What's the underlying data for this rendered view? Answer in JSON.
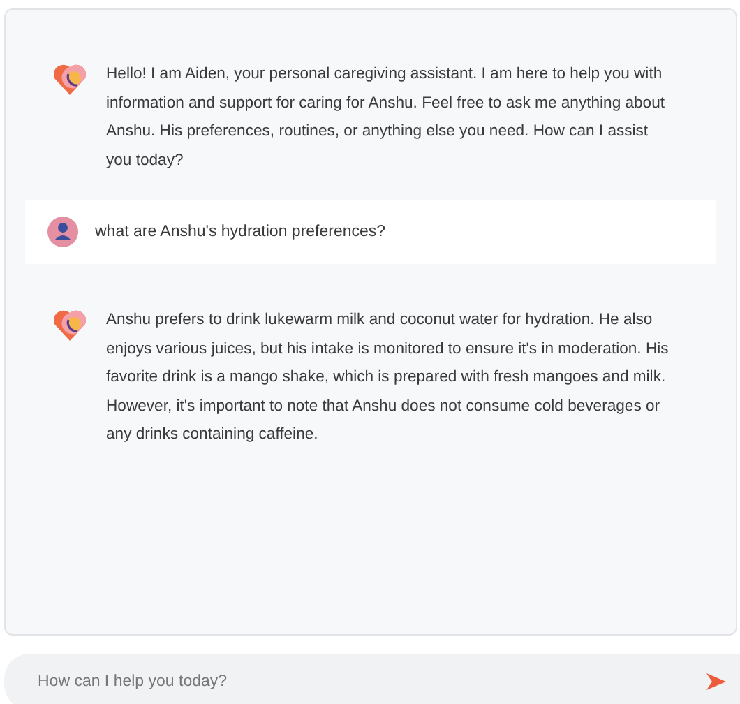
{
  "messages": [
    {
      "kind": "bot",
      "text": "Hello! I am Aiden, your personal caregiving assistant. I am here to help you with information and support for caring for Anshu. Feel free to ask me anything about Anshu. His preferences, routines, or anything else you need. How can I assist you today?"
    },
    {
      "kind": "user",
      "text": "what are Anshu's hydration preferences?"
    },
    {
      "kind": "bot",
      "text": "Anshu prefers to drink lukewarm milk and coconut water for hydration. He also enjoys various juices, but his intake is monitored to ensure it's in moderation. His favorite drink is a mango shake, which is prepared with fresh mangoes and milk. However, it's important to note that Anshu does not consume cold beverages or any drinks containing caffeine."
    }
  ],
  "composer": {
    "placeholder": "How can I help you today?"
  }
}
